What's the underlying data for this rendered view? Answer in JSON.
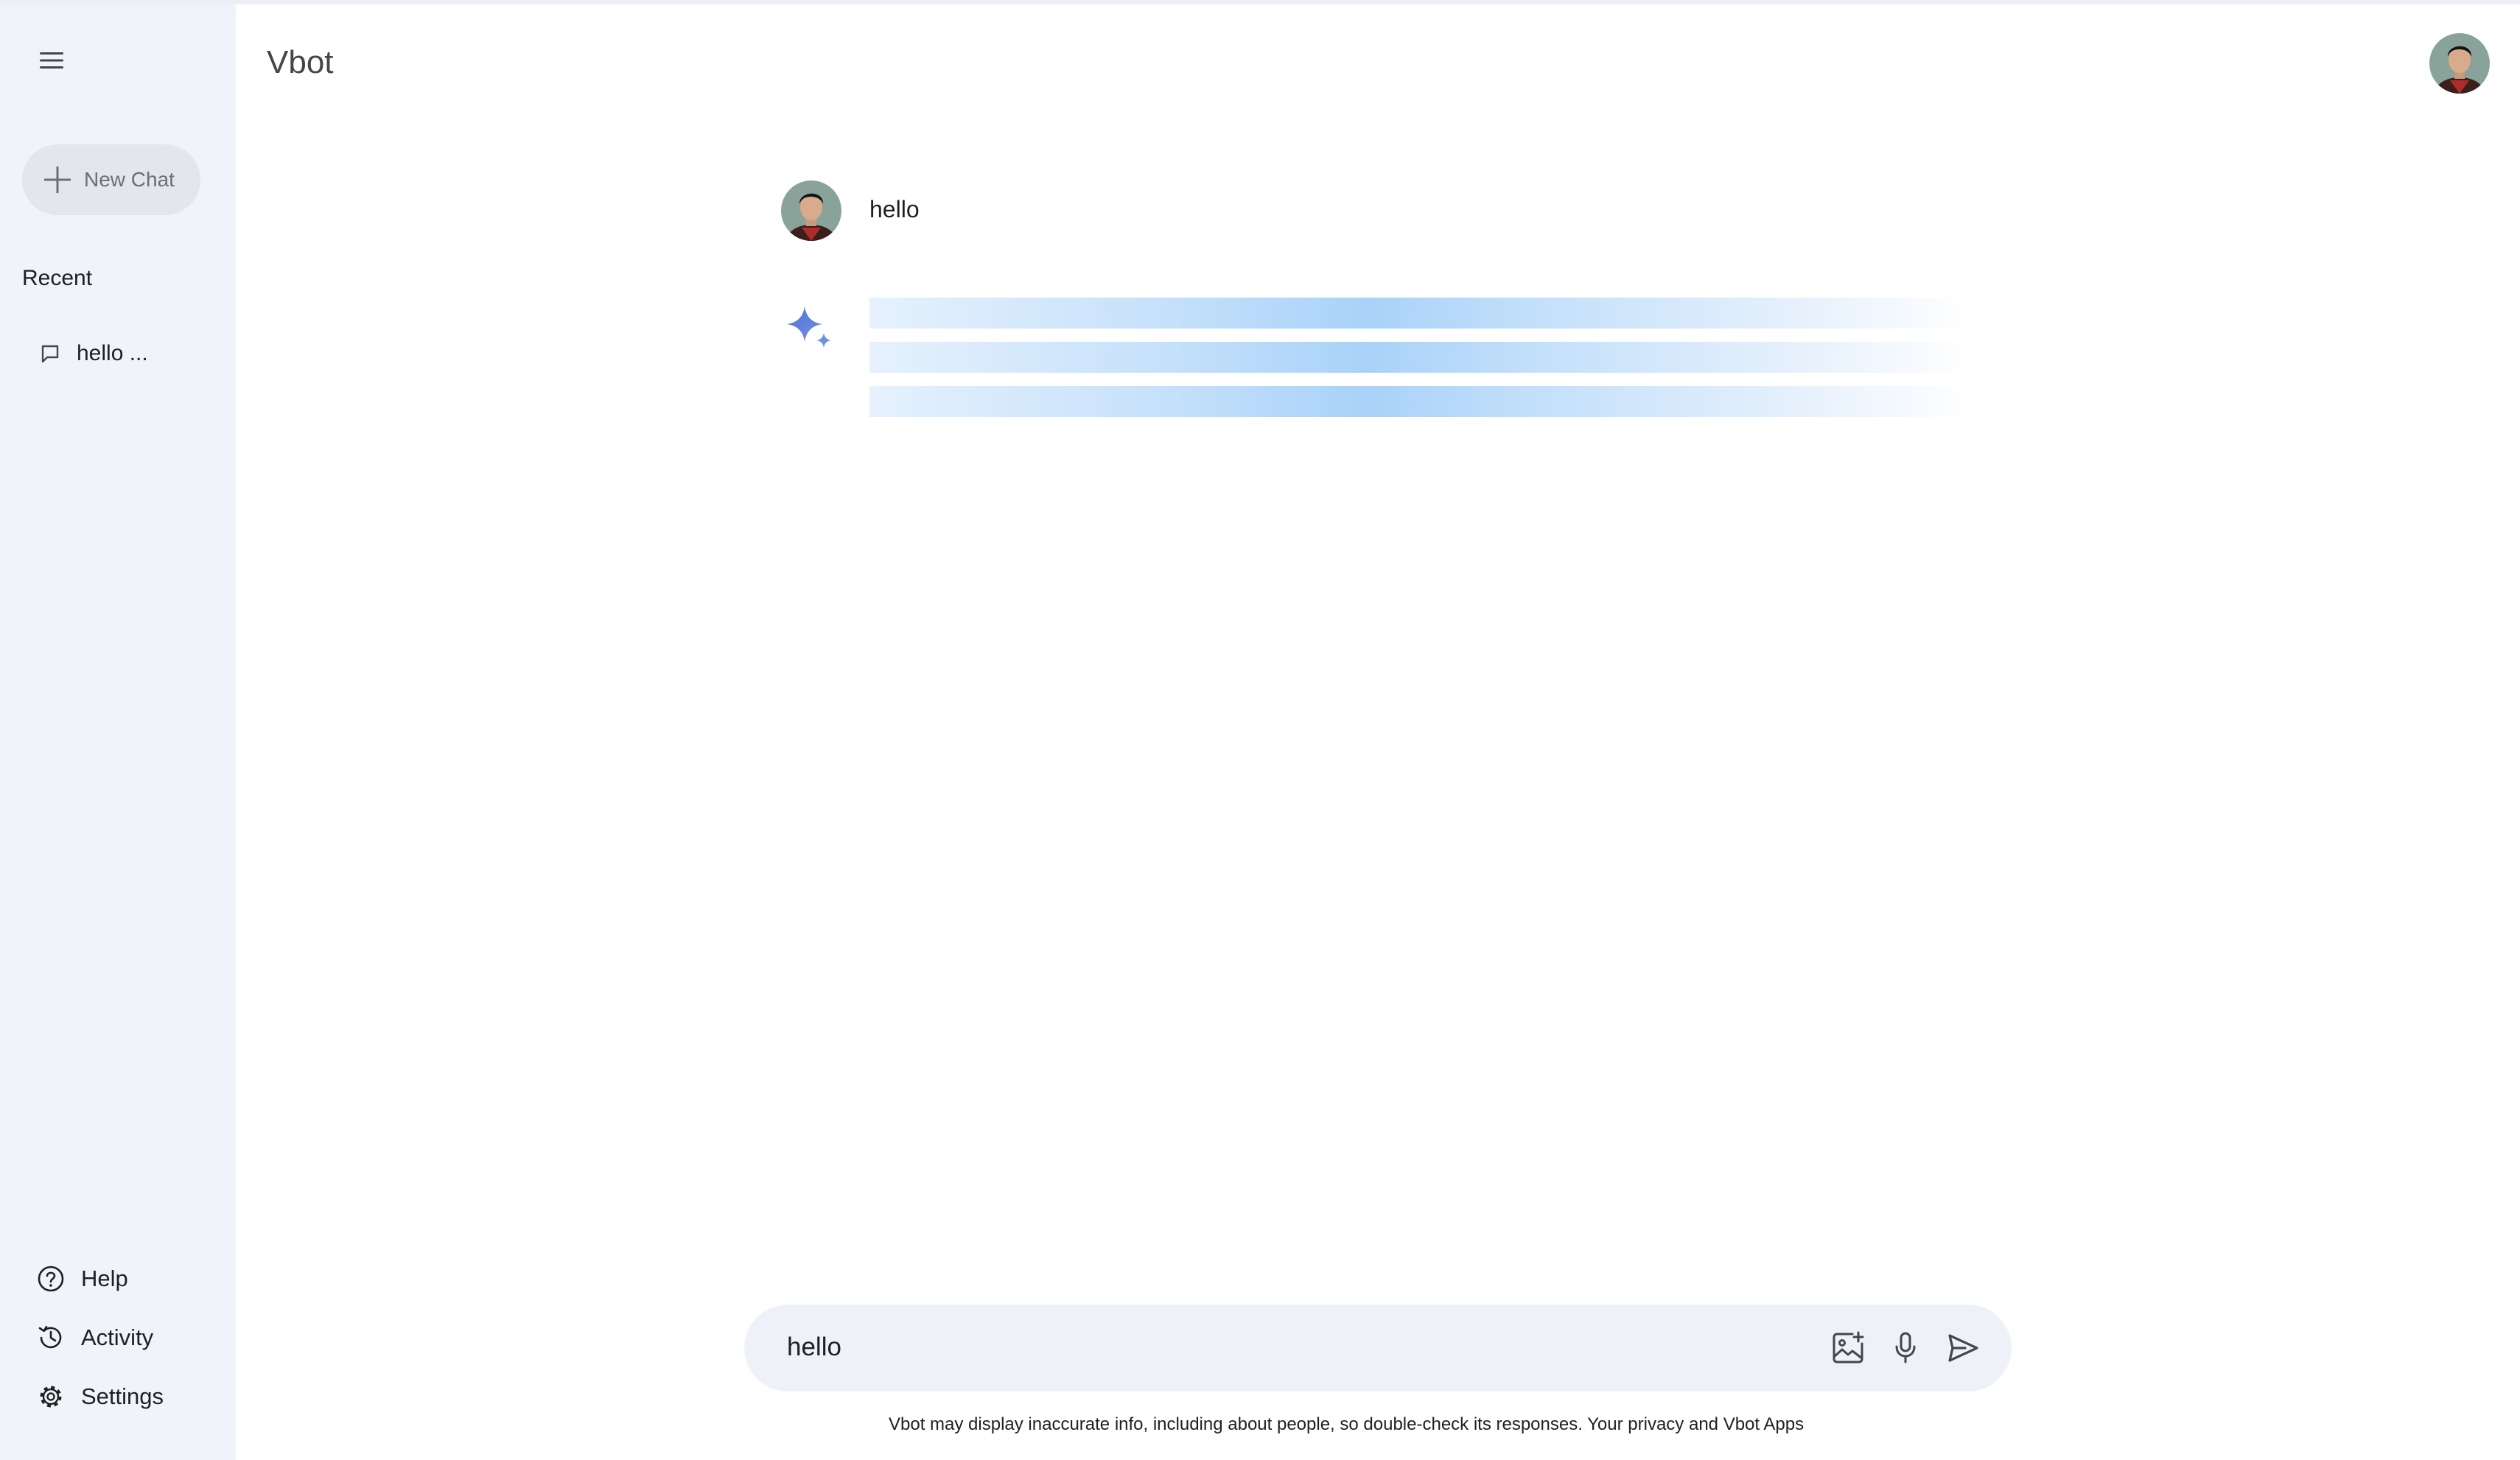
{
  "app": {
    "title": "Vbot"
  },
  "sidebar": {
    "new_chat_label": "New Chat",
    "recent_title": "Recent",
    "recent_items": [
      {
        "label": "hello ..."
      }
    ],
    "bottom_links": [
      {
        "label": "Help",
        "icon": "help-circle-icon"
      },
      {
        "label": "Activity",
        "icon": "history-icon"
      },
      {
        "label": "Settings",
        "icon": "gear-icon"
      }
    ]
  },
  "chat": {
    "user_message": "hello",
    "loading_lines": 3
  },
  "input": {
    "value": "hello",
    "icons": [
      "add-image-icon",
      "microphone-icon",
      "send-icon"
    ]
  },
  "footer": {
    "disclaimer": "Vbot may display inaccurate info, including about people, so double-check its responses. Your privacy and Vbot Apps"
  },
  "colors": {
    "sidebar_bg": "#f0f3f9",
    "input_bg": "#eef2f8",
    "loading_blue": "#a9d2f8",
    "sparkle_blue": "#4e7cd9"
  }
}
